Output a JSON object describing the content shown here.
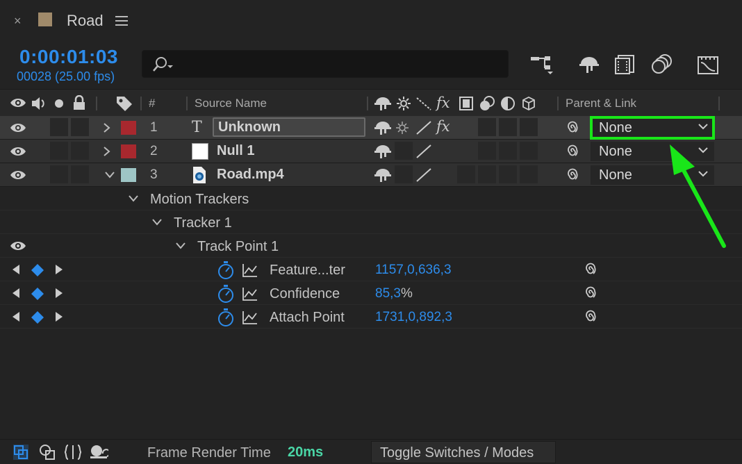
{
  "tab": {
    "title": "Road",
    "close": "×",
    "comp_color": "#a08a6a"
  },
  "timecode": {
    "value": "0:00:01:03",
    "frame_info": "00028 (25.00 fps)"
  },
  "search": {
    "placeholder": "",
    "value": ""
  },
  "header": {
    "hash": "#",
    "source_name": "Source Name",
    "parent_link": "Parent & Link"
  },
  "layers": [
    {
      "num": "1",
      "name": "Unknown",
      "label_color": "#a8282e",
      "type": "text",
      "parent": "None",
      "expanded": false
    },
    {
      "num": "2",
      "name": "Null 1",
      "label_color": "#a8282e",
      "type": "null",
      "parent": "None",
      "expanded": false
    },
    {
      "num": "3",
      "name": "Road.mp4",
      "label_color": "#9ec6c6",
      "type": "footage",
      "parent": "None",
      "expanded": true
    }
  ],
  "tree": {
    "motion_trackers": "Motion Trackers",
    "tracker": "Tracker 1",
    "track_point": "Track Point 1"
  },
  "properties": [
    {
      "name": "Feature...ter",
      "value": "1157,0,636,3",
      "suffix": ""
    },
    {
      "name": "Confidence",
      "value": "85,3",
      "suffix": "%"
    },
    {
      "name": "Attach Point",
      "value": "1731,0,892,3",
      "suffix": ""
    }
  ],
  "footer": {
    "frame_render_label": "Frame Render Time",
    "frame_render_value": "20ms",
    "toggle": "Toggle Switches / Modes"
  },
  "colors": {
    "accent_blue": "#2d8ceb",
    "highlight_green": "#19e619",
    "render_green": "#4ad6a6"
  }
}
